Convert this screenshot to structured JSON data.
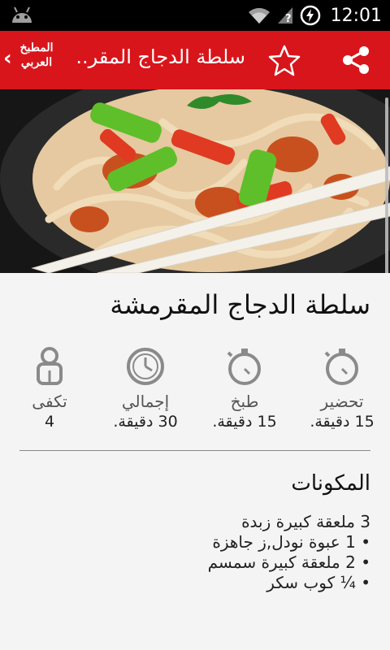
{
  "status_bar": {
    "time": "12:01"
  },
  "app_bar": {
    "logo_line1": "المطبخ",
    "logo_line2": "العربي",
    "title": "سلطة الدجاج المقر..."
  },
  "recipe": {
    "title": "سلطة الدجاج المقرمشة",
    "stats": [
      {
        "label": "تحضير",
        "value": "15 دقيقة.",
        "icon": "stopwatch-icon"
      },
      {
        "label": "طبخ",
        "value": "15 دقيقة.",
        "icon": "stopwatch-icon"
      },
      {
        "label": "إجمالي",
        "value": "30 دقيقة.",
        "icon": "clock-icon"
      },
      {
        "label": "تكفى",
        "value": "4",
        "icon": "person-icon"
      }
    ]
  },
  "ingredients": {
    "heading": "المكونات",
    "items": [
      "3 ملعقة كبيرة زبدة",
      "• 1 عبوة نودل,ز جاهزة",
      "• 2 ملعقة كبيرة سمسم",
      "• ¼ كوب سكر"
    ]
  },
  "colors": {
    "app_bar": "#d8151b",
    "status_bar": "#000000",
    "background": "#f4f4f4"
  }
}
